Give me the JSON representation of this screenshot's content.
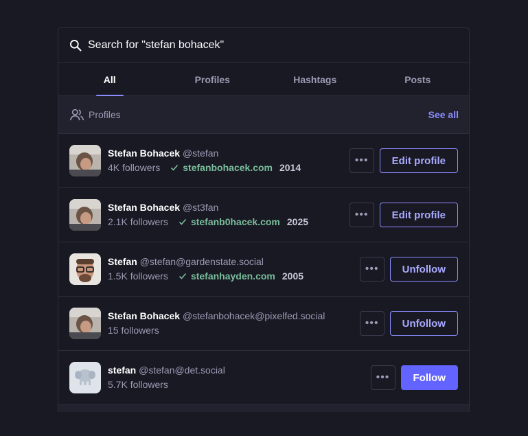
{
  "search": {
    "query": "Search for \"stefan bohacek\"",
    "icon": "search-icon"
  },
  "tabs": [
    {
      "label": "All",
      "active": true
    },
    {
      "label": "Profiles",
      "active": false
    },
    {
      "label": "Hashtags",
      "active": false
    },
    {
      "label": "Posts",
      "active": false
    }
  ],
  "section": {
    "title": "Profiles",
    "icon": "people-icon",
    "see_all": "See all"
  },
  "more_label": "•••",
  "profiles": [
    {
      "name": "Stefan Bohacek",
      "handle": "@stefan",
      "followers": "4K followers",
      "verified_link": "stefanbohacek.com",
      "year": "2014",
      "action": "Edit profile",
      "action_style": "outline"
    },
    {
      "name": "Stefan Bohacek",
      "handle": "@st3fan",
      "followers": "2.1K followers",
      "verified_link": "stefanb0hacek.com",
      "year": "2025",
      "action": "Edit profile",
      "action_style": "outline"
    },
    {
      "name": "Stefan",
      "handle": "@stefan@gardenstate.social",
      "followers": "1.5K followers",
      "verified_link": "stefanhayden.com",
      "year": "2005",
      "action": "Unfollow",
      "action_style": "outline"
    },
    {
      "name": "Stefan Bohacek",
      "handle": "@stefanbohacek@pixelfed.social",
      "followers": "15 followers",
      "verified_link": "",
      "year": "",
      "action": "Unfollow",
      "action_style": "outline"
    },
    {
      "name": "stefan",
      "handle": "@stefan@det.social",
      "followers": "5.7K followers",
      "verified_link": "",
      "year": "",
      "action": "Follow",
      "action_style": "solid"
    }
  ],
  "colors": {
    "accent": "#8c8dff",
    "verified": "#79bd9a",
    "background": "#191924"
  }
}
